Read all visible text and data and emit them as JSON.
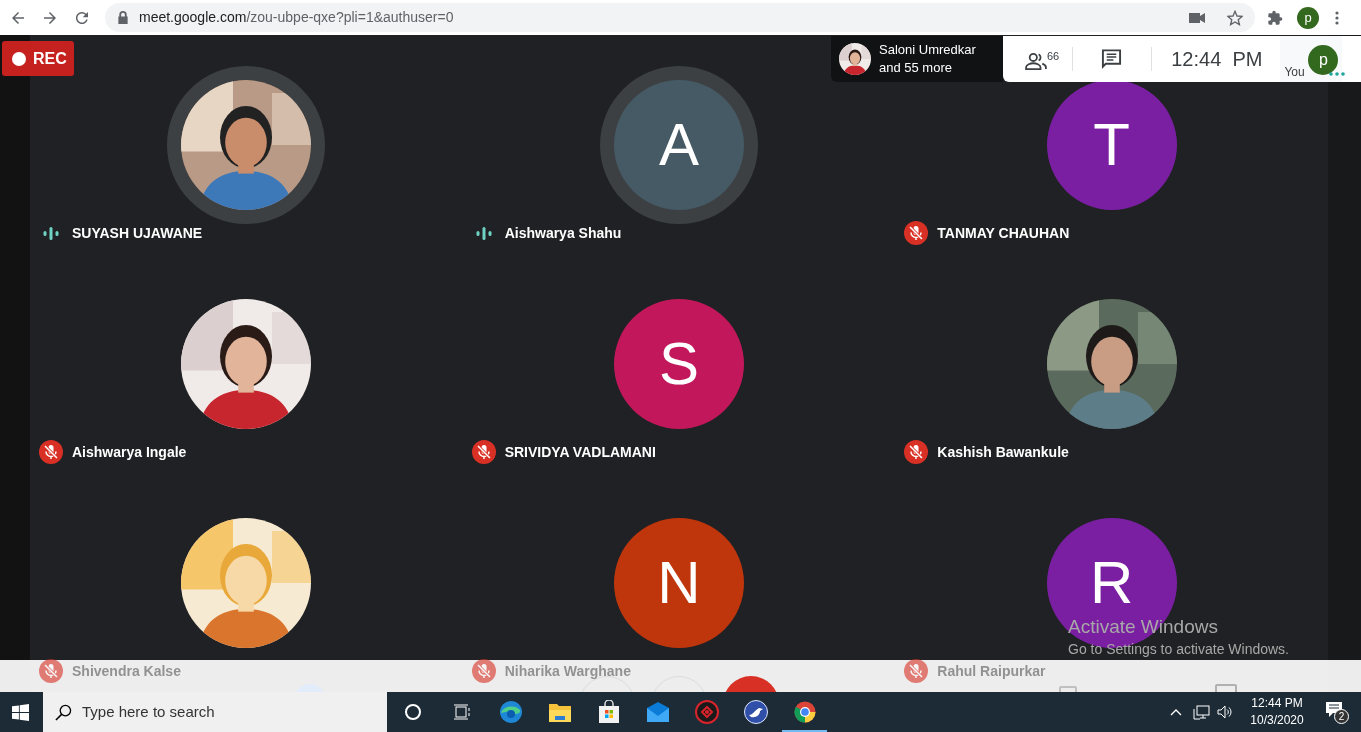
{
  "browser": {
    "url_host": "meet.google.com",
    "url_path": "/zou-ubpe-qxe?pli=1&authuser=0",
    "profile_initial": "p"
  },
  "recording": {
    "label": "REC"
  },
  "presenter_chip": {
    "name": "Saloni Umredkar",
    "more": "and 55 more"
  },
  "toolbar": {
    "participant_count": "66",
    "time": "12:44  PM",
    "self_label": "You",
    "self_initial": "p"
  },
  "participants": [
    {
      "name": "SUYASH UJAWANE",
      "kind": "picture",
      "muted": false
    },
    {
      "name": "Aishwarya Shahu",
      "kind": "letter",
      "initial": "A",
      "color": "#455a64",
      "muted": false
    },
    {
      "name": "TANMAY CHAUHAN",
      "kind": "letter",
      "initial": "T",
      "color": "#7b1fa2",
      "muted": true
    },
    {
      "name": "Aishwarya Ingale",
      "kind": "picture",
      "muted": true
    },
    {
      "name": "SRIVIDYA VADLAMANI",
      "kind": "letter",
      "initial": "S",
      "color": "#c2185b",
      "muted": true
    },
    {
      "name": "Kashish Bawankule",
      "kind": "picture",
      "muted": true
    },
    {
      "name": "Shivendra Kalse",
      "kind": "picture",
      "muted": true
    },
    {
      "name": "Niharika Warghane",
      "kind": "letter",
      "initial": "N",
      "color": "#bf360c",
      "muted": true
    },
    {
      "name": "Rahul Raipurkar",
      "kind": "letter",
      "initial": "R",
      "color": "#7b1fa2",
      "muted": true
    }
  ],
  "activation_notice": {
    "title": "Activate Windows",
    "subtitle": "Go to Settings to activate Windows."
  },
  "taskbar": {
    "search_placeholder": "Type here to search",
    "apps": [
      {
        "kind": "cortana",
        "selected": false
      },
      {
        "kind": "taskview",
        "selected": false
      },
      {
        "kind": "edge",
        "selected": false
      },
      {
        "kind": "files",
        "selected": false
      },
      {
        "kind": "store",
        "selected": false
      },
      {
        "kind": "mail",
        "selected": false
      },
      {
        "kind": "game",
        "selected": false
      },
      {
        "kind": "bird",
        "selected": false
      },
      {
        "kind": "chrome",
        "selected": true
      }
    ],
    "clock_time": "12:44 PM",
    "clock_date": "10/3/2020",
    "notifications": "2"
  }
}
